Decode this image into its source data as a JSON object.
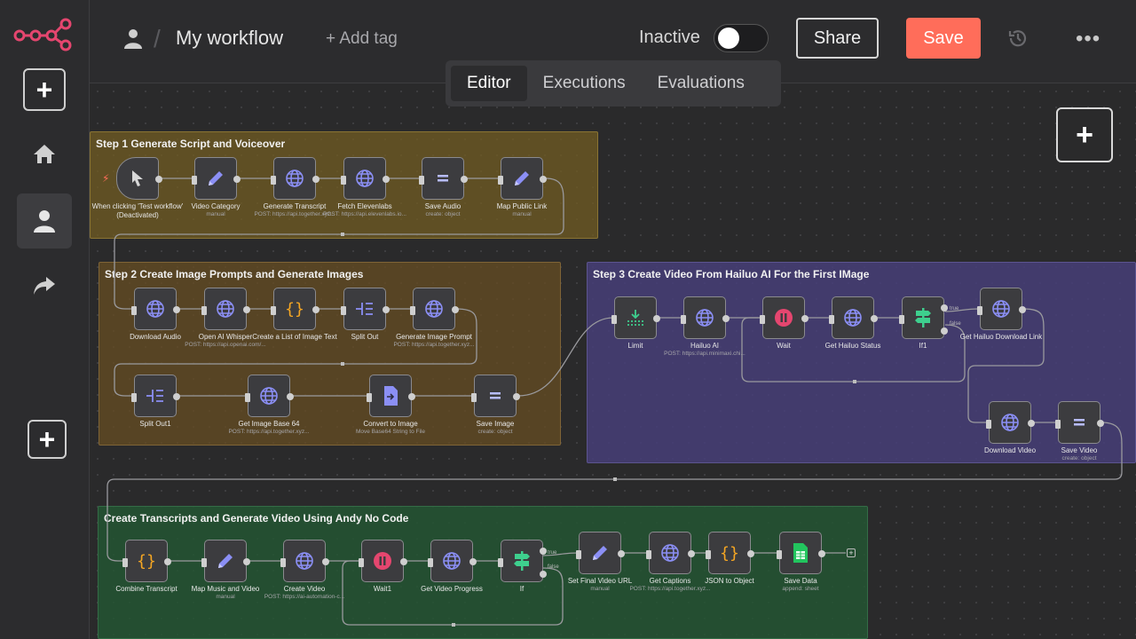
{
  "header": {
    "title": "My workflow",
    "add_tag": "+ Add tag",
    "status": "Inactive",
    "share": "Share",
    "save": "Save",
    "more": "•••"
  },
  "tabs": [
    "Editor",
    "Executions",
    "Evaluations"
  ],
  "colors": {
    "accent": "#ff6d5a",
    "globe": "#8b8ff5",
    "orange": "#f5a623",
    "green": "#3ecf8e",
    "red": "#e5466f"
  },
  "groups": [
    "Step 1 Generate Script and Voiceover",
    "Step 2 Create Image Prompts and Generate Images",
    "Step 3 Create Video From Hailuo AI For the First IMage",
    "Create Transcripts and Generate Video Using Andy No Code"
  ],
  "nodes": {
    "n1": {
      "label": "When clicking 'Test workflow' (Deactivated)",
      "sub": "",
      "icon": "cursor-icon"
    },
    "n2": {
      "label": "Video Category",
      "sub": "manual",
      "icon": "pencil-icon"
    },
    "n3": {
      "label": "Generate Transcript",
      "sub": "POST: https://api.together.xyz...",
      "icon": "globe-icon"
    },
    "n4": {
      "label": "Fetch Elevenlabs",
      "sub": "POST: https://api.elevenlabs.io...",
      "icon": "globe-icon"
    },
    "n5": {
      "label": "Save Audio",
      "sub": "create: object",
      "icon": "equals-icon"
    },
    "n6": {
      "label": "Map Public Link",
      "sub": "manual",
      "icon": "pencil-icon"
    },
    "n7": {
      "label": "Download Audio",
      "sub": "",
      "icon": "globe-icon"
    },
    "n8": {
      "label": "Open AI Whisper",
      "sub": "POST: https://api.openai.com/...",
      "icon": "globe-icon"
    },
    "n9": {
      "label": "Create a List of Image Text",
      "sub": "",
      "icon": "braces-icon"
    },
    "n10": {
      "label": "Split Out",
      "sub": "",
      "icon": "split-icon"
    },
    "n11": {
      "label": "Generate Image Prompt",
      "sub": "POST: https://api.together.xyz...",
      "icon": "globe-icon"
    },
    "n12": {
      "label": "Split Out1",
      "sub": "",
      "icon": "split-icon"
    },
    "n13": {
      "label": "Get Image Base 64",
      "sub": "POST: https://api.together.xyz...",
      "icon": "globe-icon"
    },
    "n14": {
      "label": "Convert to Image",
      "sub": "Move Base64 String to File",
      "icon": "file-icon"
    },
    "n15": {
      "label": "Save Image",
      "sub": "create: object",
      "icon": "equals-icon"
    },
    "n16": {
      "label": "Limit",
      "sub": "",
      "icon": "limit-icon"
    },
    "n17": {
      "label": "Hailuo AI",
      "sub": "POST: https://api.minimaxi.chi...",
      "icon": "globe-icon"
    },
    "n18": {
      "label": "Wait",
      "sub": "",
      "icon": "pause-icon"
    },
    "n19": {
      "label": "Get Hailuo Status",
      "sub": "",
      "icon": "globe-icon"
    },
    "n20": {
      "label": "If1",
      "sub": "",
      "icon": "signpost-icon"
    },
    "n21": {
      "label": "Get Hailuo Download Link",
      "sub": "",
      "icon": "globe-icon"
    },
    "n22": {
      "label": "Download Video",
      "sub": "",
      "icon": "globe-icon"
    },
    "n23": {
      "label": "Save Video",
      "sub": "create: object",
      "icon": "equals-icon"
    },
    "n24": {
      "label": "Combine Transcript",
      "sub": "",
      "icon": "braces-icon"
    },
    "n25": {
      "label": "Map Music and Video",
      "sub": "manual",
      "icon": "pencil-icon"
    },
    "n26": {
      "label": "Create Video",
      "sub": "POST: https://ai-automation-c...",
      "icon": "globe-icon"
    },
    "n27": {
      "label": "Wait1",
      "sub": "",
      "icon": "pause-icon"
    },
    "n28": {
      "label": "Get Video Progress",
      "sub": "",
      "icon": "globe-icon"
    },
    "n29": {
      "label": "If",
      "sub": "",
      "icon": "signpost-icon"
    },
    "n30": {
      "label": "Set Final Video URL",
      "sub": "manual",
      "icon": "pencil-icon"
    },
    "n31": {
      "label": "Get Captions",
      "sub": "POST: https://api.together.xyz...",
      "icon": "globe-icon"
    },
    "n32": {
      "label": "JSON to Object",
      "sub": "",
      "icon": "braces-icon"
    },
    "n33": {
      "label": "Save Data",
      "sub": "append: sheet",
      "icon": "sheet-icon"
    }
  },
  "branch": {
    "true": "true",
    "false": "false"
  }
}
